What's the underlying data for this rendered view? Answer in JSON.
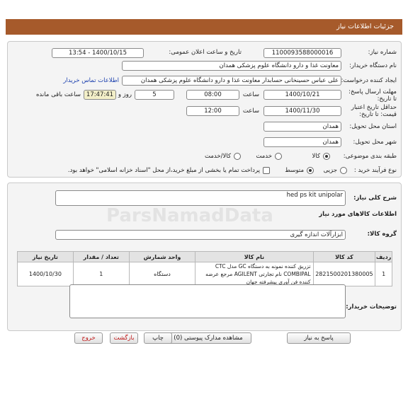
{
  "header": {
    "title": "جزئیات اطلاعات نیاز"
  },
  "info": {
    "need_number_label": "شماره نیاز:",
    "need_number": "1100093588000016",
    "announce_label": "تاریخ و ساعت اعلان عمومی:",
    "announce_value": "1400/10/15 - 13:54",
    "buyer_label": "نام دستگاه خریدار:",
    "buyer_value": "معاونت غذا و دارو دانشگاه علوم پزشکی همدان",
    "requester_label": "ایجاد کننده درخواست:",
    "requester_value": "علی عباس  حسینخانی حسابدار معاونت غذا و دارو دانشگاه علوم پزشکی همدان",
    "contact_link": "اطلاعات تماس خریدار",
    "deadline_label": "مهلت ارسال پاسخ: تا تاریخ:",
    "deadline_date": "1400/10/21",
    "time_label": "ساعت",
    "deadline_time": "08:00",
    "days_value": "5",
    "days_label": "روز و",
    "remaining_time": "17:47:41",
    "remaining_label": "ساعت باقی مانده",
    "validity_label": "حداقل تاریخ اعتبار قیمت: تا تاریخ:",
    "validity_date": "1400/11/30",
    "validity_time": "12:00",
    "province_label": "استان محل تحویل:",
    "province_value": "همدان",
    "city_label": "شهر محل تحویل:",
    "city_value": "همدان",
    "category_label": "طبقه بندی موضوعی:",
    "category_options": [
      "کالا",
      "خدمت",
      "کالا/خدمت"
    ],
    "category_selected": "کالا",
    "process_label": "نوع فرآیند خرید :",
    "process_options": [
      "جزیی",
      "متوسط"
    ],
    "process_selected": "متوسط",
    "payment_note": "پرداخت تمام یا بخشی از مبلغ خرید،از محل \"اسناد خزانه اسلامی\" خواهد بود."
  },
  "details": {
    "general_desc_label": "شرح کلی نیاز:",
    "general_desc": "hed ps kit unipolar",
    "goods_info_title": "اطلاعات کالاهای مورد نیاز",
    "group_label": "گروه کالا:",
    "group_value": "ابزارآلات اندازه گیری",
    "table_headers": [
      "ردیف",
      "کد کالا",
      "نام کالا",
      "واحد شمارش",
      "تعداد / مقدار",
      "تاریخ نیاز"
    ],
    "rows": [
      {
        "row": "1",
        "code": "2821500201380005",
        "name": "تزریق کننده نمونه به دستگاه GC مدل CTC COMBIPAL نام تجارتی AGILENT مرجع عرضه کننده فن آوری پیشرفته جهان",
        "unit": "دستگاه",
        "qty": "1",
        "date": "1400/10/30"
      }
    ],
    "buyer_notes_label": "توضیحات خریدار:",
    "buyer_notes": ""
  },
  "buttons": {
    "reply": "پاسخ به نیاز",
    "attachments": "مشاهده مدارک پیوستی (0)",
    "print": "چاپ",
    "back": "بازگشت",
    "exit": "خروج"
  },
  "watermark": "ParsNamadData"
}
